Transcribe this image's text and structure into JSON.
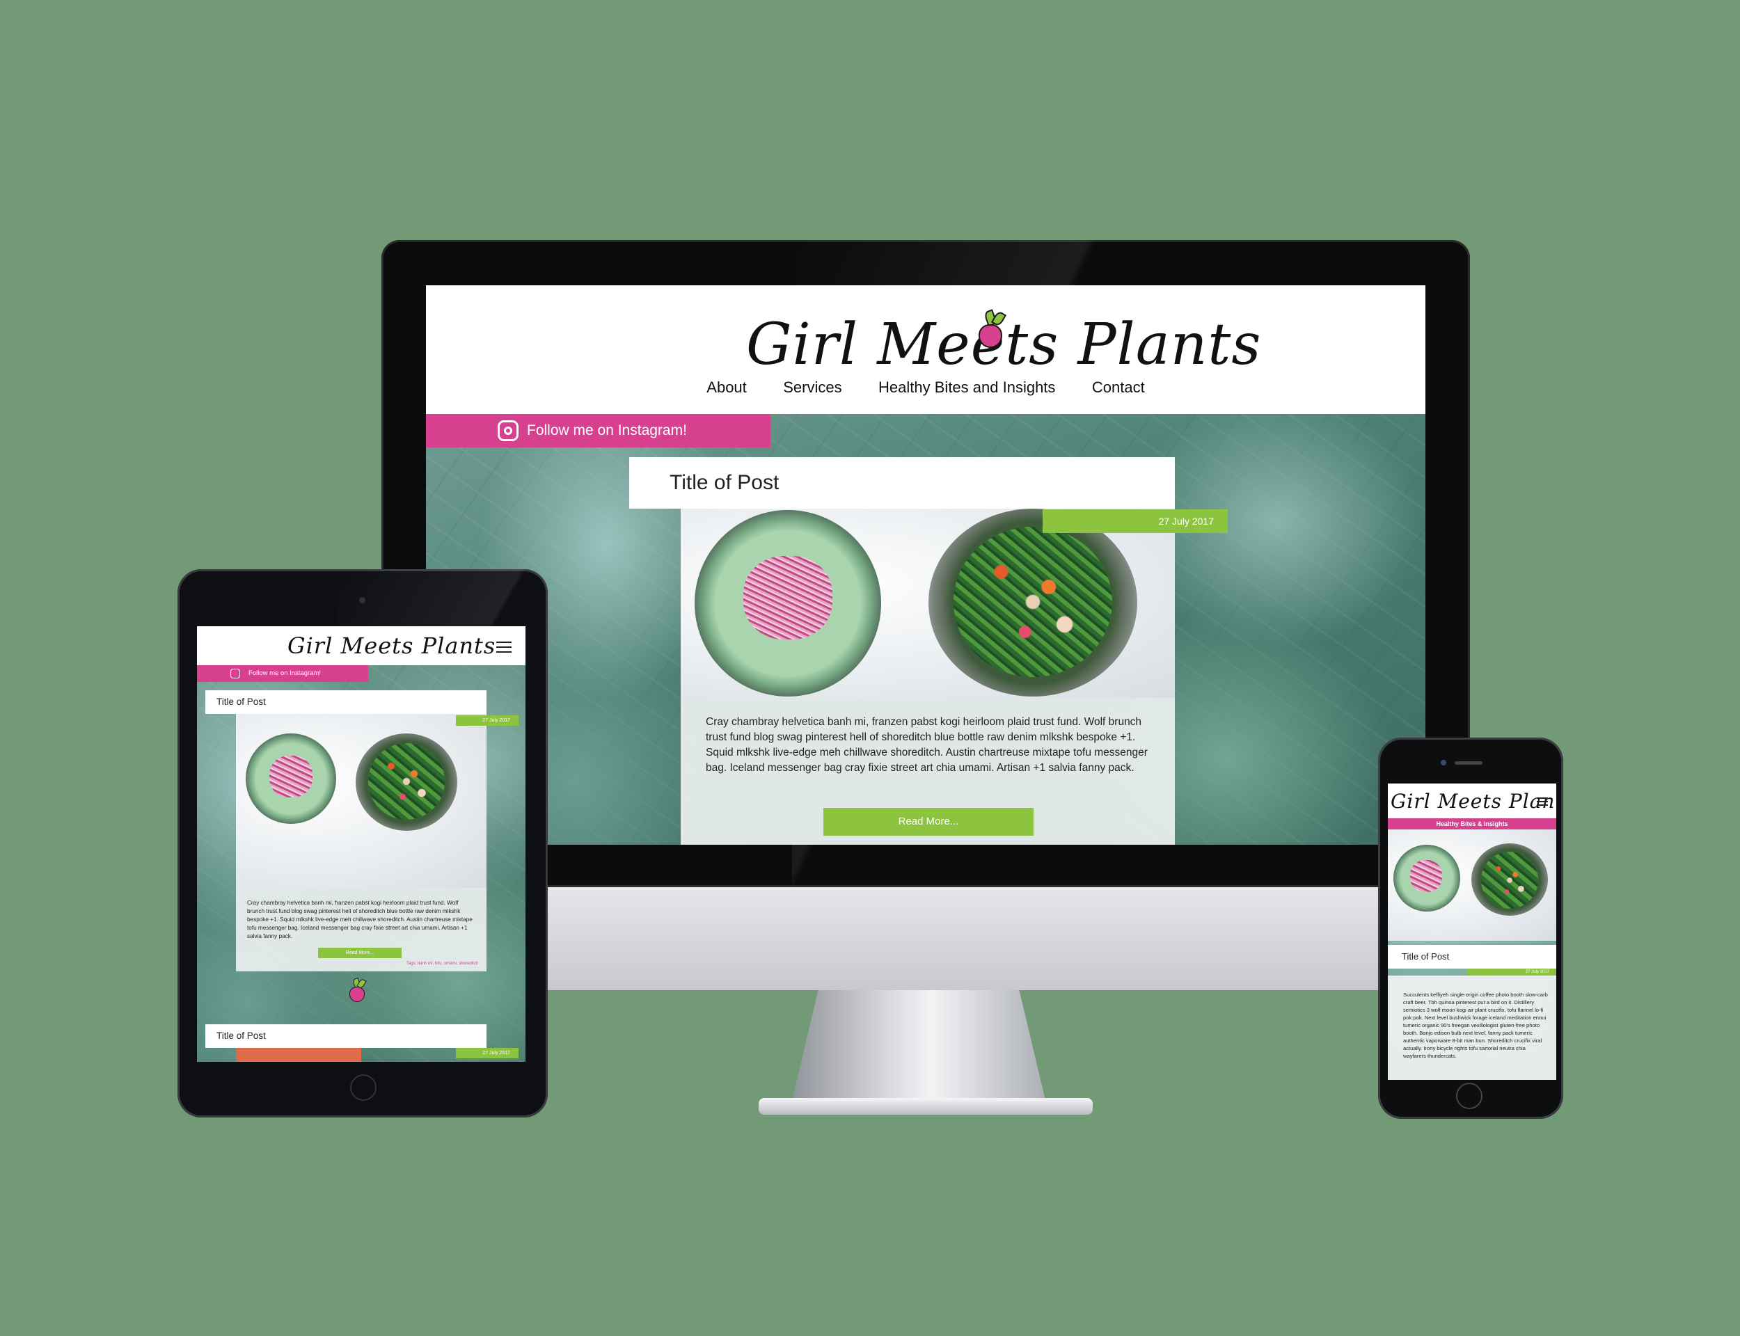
{
  "brand": {
    "logo_text": "Girl Meets Plants",
    "accent_pink": "#d6408f",
    "accent_green": "#8cc43f",
    "background": "#739a77"
  },
  "desktop": {
    "nav": [
      "About",
      "Services",
      "Healthy Bites and Insights",
      "Contact"
    ],
    "instagram_label": "Follow me on Instagram!",
    "post": {
      "title": "Title of Post",
      "date": "27 July 2017",
      "body": "Cray chambray helvetica banh mi, franzen pabst kogi heirloom plaid trust fund. Wolf brunch trust fund blog swag pinterest hell of shoreditch blue bottle raw denim mlkshk bespoke +1. Squid mlkshk live-edge meh chillwave shoreditch. Austin chartreuse mixtape tofu messenger bag. Iceland messenger bag cray fixie street art chia umami. Artisan +1 salvia fanny pack.",
      "read_more": "Read More..."
    }
  },
  "tablet": {
    "instagram_label": "Follow me on Instagram!",
    "posts": [
      {
        "title": "Title of Post",
        "date": "27 July 2017",
        "body": "Cray chambray helvetica banh mi, franzen pabst kogi heirloom plaid trust fund. Wolf brunch trust fund blog swag pinterest hell of shoreditch blue bottle raw denim mlkshk bespoke +1. Squid mlkshk live-edge meh chillwave shoreditch. Austin chartreuse mixtape tofu messenger bag. Iceland messenger bag cray fixie street art chia umami. Artisan +1 salvia fanny pack.",
        "read_more": "Read More...",
        "tags": "Tags: banh mi, tofu, umami, shoreditch"
      },
      {
        "title": "Title of Post",
        "date": "27 July 2017"
      }
    ]
  },
  "phone": {
    "menu_label": "Healthy Bites & Insights",
    "post": {
      "title": "Title of Post",
      "date": "27 July 2017",
      "body": "Succulents keffiyeh single-origin coffee photo booth slow-carb craft beer. Tbh quinoa pinterest put a bird on it. Distillery semiotics 3 wolf moon kogi air plant crucifix, tofu flannel lo-fi pok pok. Next level bushwick forage iceland meditation ennui tumeric organic 90's freegan vexillologist gluten-free photo booth. Banjo edison bulb next level, fanny pack tumeric authentic vaporware 8-bit man bun. Shoreditch crucifix viral actually. Irony bicycle rights tofu sartorial neutra chia wayfarers thundercats."
    }
  },
  "icons": [
    "instagram-icon",
    "hamburger-menu-icon",
    "beet-logo-icon"
  ]
}
